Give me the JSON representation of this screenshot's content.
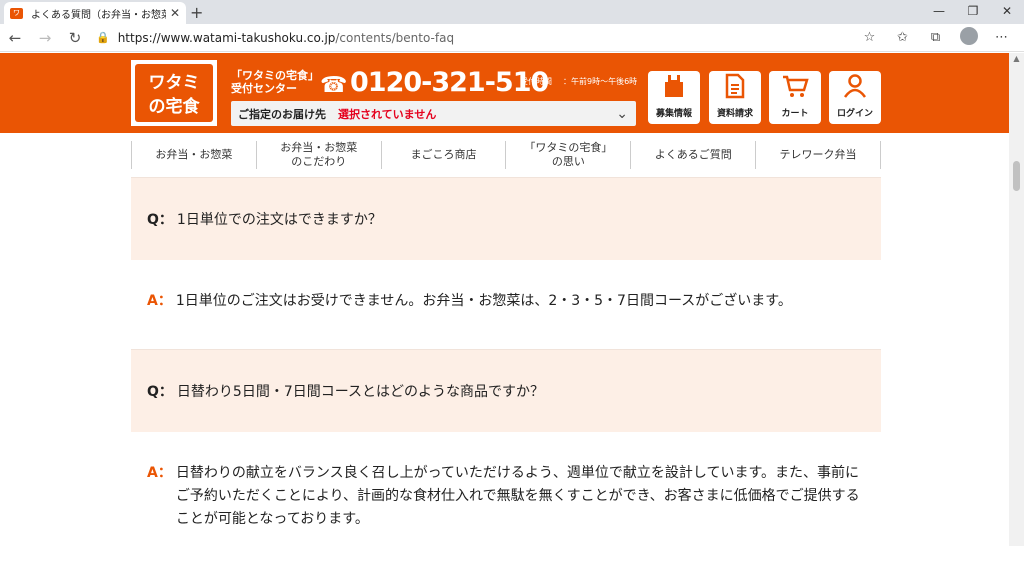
{
  "browser": {
    "tab_title": "よくある質問（お弁当・お惣菜）| ワ",
    "tab_favicon": "ワ",
    "url_domain": "https://www.watami-takushoku.co.jp",
    "url_path": "/contents/bento-faq"
  },
  "header": {
    "logo_line1": "ワタミ",
    "logo_line2": "の宅食",
    "center_label_line1": "「ワタミの宅食」",
    "center_label_line2": "受付センター",
    "phone": "0120-321-510",
    "hours_label": "受付時間",
    "hours": "：午前9時～午後6時",
    "destination_label": "ご指定のお届け先",
    "destination_value": "選択されていません",
    "buttons": [
      {
        "label": "募集情報",
        "icon": "apron-icon"
      },
      {
        "label": "資料請求",
        "icon": "document-icon"
      },
      {
        "label": "カート",
        "icon": "cart-icon"
      },
      {
        "label": "ログイン",
        "icon": "user-icon"
      }
    ]
  },
  "nav": [
    {
      "line1": "お弁当・お惣菜",
      "line2": ""
    },
    {
      "line1": "お弁当・お惣菜",
      "line2": "のこだわり"
    },
    {
      "line1": "まごころ商店",
      "line2": ""
    },
    {
      "line1": "「ワタミの宅食」",
      "line2": "の思い"
    },
    {
      "line1": "よくあるご質問",
      "line2": ""
    },
    {
      "line1": "テレワーク弁当",
      "line2": ""
    }
  ],
  "faq": {
    "q_mark": "Q：",
    "a_mark": "A：",
    "items": [
      {
        "q": "1日単位での注文はできますか？",
        "a": "1日単位のご注文はお受けできません。お弁当・お惣菜は、2・3・5・7日間コースがございます。"
      },
      {
        "q": "日替わり5日間・7日間コースとはどのような商品ですか？",
        "a": "日替わりの献立をバランス良く召し上がっていただけるよう、週単位で献立を設計しています。また、事前にご予約いただくことにより、計画的な食材仕入れで無駄を無くすことができ、お客さまに低価格でご提供することが可能となっております。"
      }
    ]
  },
  "colors": {
    "brand": "#ea5504",
    "question_bg": "#fdefe6",
    "destination_value": "#e5001d"
  }
}
